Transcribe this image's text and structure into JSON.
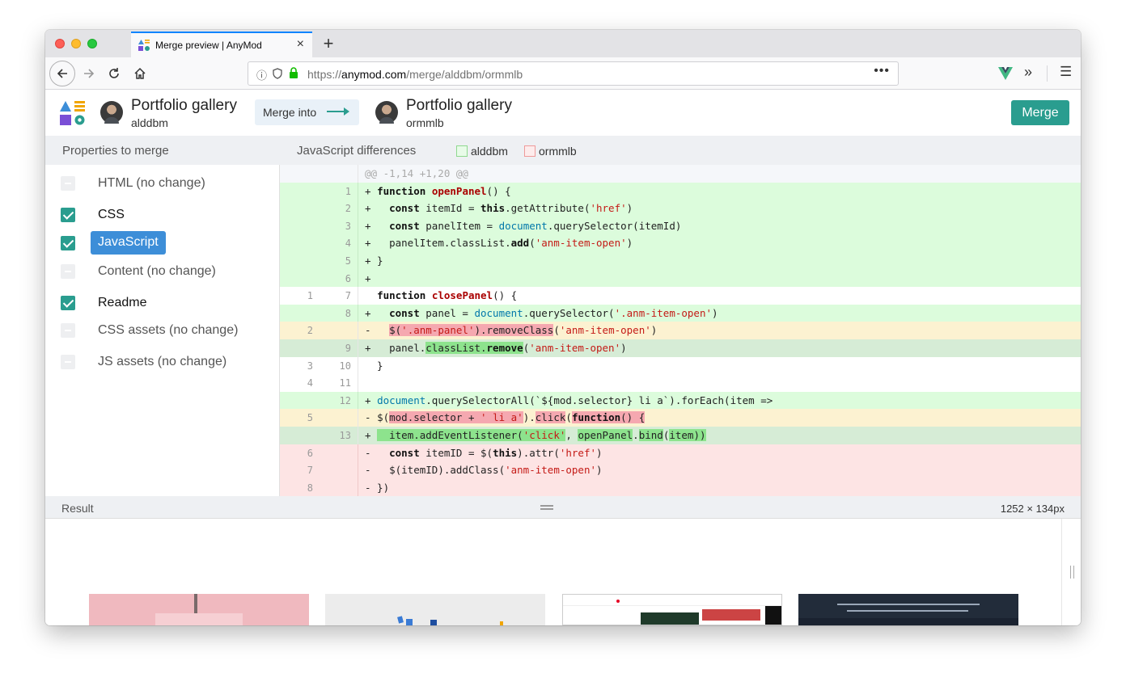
{
  "browser": {
    "tab_title": "Merge preview | AnyMod",
    "url_scheme": "https://",
    "url_host": "anymod.com",
    "url_path": "/merge/alddbm/ormmlb"
  },
  "header": {
    "source": {
      "name": "Portfolio gallery",
      "user": "alddbm"
    },
    "merge_into_label": "Merge into",
    "target": {
      "name": "Portfolio gallery",
      "user": "ormmlb"
    },
    "merge_button": "Merge"
  },
  "subheader": {
    "properties_title": "Properties to merge",
    "diff_title": "JavaScript differences",
    "legend_source": "alddbm",
    "legend_target": "ormmlb"
  },
  "properties": [
    {
      "label": "HTML (no change)",
      "state": "none"
    },
    {
      "label": "CSS",
      "state": "checked"
    },
    {
      "label": "JavaScript",
      "state": "selected"
    },
    {
      "label": "Content (no change)",
      "state": "none"
    },
    {
      "label": "Readme",
      "state": "checked"
    },
    {
      "label": "CSS assets (no change)",
      "state": "none"
    },
    {
      "label": "JS assets (no change)",
      "state": "none"
    }
  ],
  "diff": {
    "hunk_header": "@@ -1,14 +1,20 @@",
    "lines": [
      {
        "old": "",
        "new": "1"
      },
      {
        "old": "",
        "new": "2"
      },
      {
        "old": "",
        "new": "3"
      },
      {
        "old": "",
        "new": "4"
      },
      {
        "old": "",
        "new": "5"
      },
      {
        "old": "",
        "new": "6"
      },
      {
        "old": "1",
        "new": "7"
      },
      {
        "old": "",
        "new": "8"
      },
      {
        "old": "2",
        "new": ""
      },
      {
        "old": "",
        "new": "9"
      },
      {
        "old": "3",
        "new": "10"
      },
      {
        "old": "4",
        "new": "11"
      },
      {
        "old": "",
        "new": "12"
      },
      {
        "old": "5",
        "new": ""
      },
      {
        "old": "",
        "new": "13"
      },
      {
        "old": "6",
        "new": ""
      },
      {
        "old": "7",
        "new": ""
      },
      {
        "old": "8",
        "new": ""
      }
    ],
    "code": {
      "l1_plus": "+ ",
      "l1_kw": "function",
      "l1_sp": " ",
      "l1_fn": "openPanel",
      "l1_rest": "() {",
      "l2_plus": "+   ",
      "l2_kw": "const",
      "l2_a": " itemId = ",
      "l2_this": "this",
      "l2_b": ".getAttribute(",
      "l2_str": "'href'",
      "l2_c": ")",
      "l3_plus": "+   ",
      "l3_kw": "const",
      "l3_a": " panelItem = ",
      "l3_doc": "document",
      "l3_b": ".querySelector(itemId)",
      "l4_plus": "+   ",
      "l4_a": "panelItem.classList.",
      "l4_add": "add",
      "l4_b": "(",
      "l4_str": "'anm-item-open'",
      "l4_c": ")",
      "l5": "+ }",
      "l6": "+",
      "l7_sp": "  ",
      "l7_kw": "function",
      "l7_s2": " ",
      "l7_fn": "closePanel",
      "l7_rest": "() {",
      "l8_plus": "+   ",
      "l8_kw": "const",
      "l8_a": " panel = ",
      "l8_doc": "document",
      "l8_b": ".querySelector(",
      "l8_str": "'.anm-item-open'",
      "l8_c": ")",
      "l9_minus": "-   ",
      "l9_a": "$(",
      "l9_str": "'.anm-panel'",
      "l9_b": ").",
      "l9_rm": "removeClass",
      "l9_c": "(",
      "l9_str2": "'anm-item-open'",
      "l9_d": ")",
      "l10_plus": "+   ",
      "l10_a": "panel.",
      "l10_cl": "classList.",
      "l10_rm": "remove",
      "l10_b": "(",
      "l10_str": "'anm-item-open'",
      "l10_c": ")",
      "l11": "  }",
      "l12": "",
      "l13_plus": "+ ",
      "l13_doc": "document",
      "l13_a": ".querySelectorAll(`${mod.selector} li a`).forEach(item =>",
      "l14_minus": "- ",
      "l14_a": "$(",
      "l14_h1": "mod.selector + ",
      "l14_str": "' li a'",
      "l14_b": ").",
      "l14_click": "click",
      "l14_c": "(",
      "l14_fn": "function",
      "l14_d": "() {",
      "l15_plus": "+ ",
      "l15_a": "  item.addEventListener(",
      "l15_str": "'click'",
      "l15_b": ", ",
      "l15_h2": "openPanel",
      "l15_c": ".",
      "l15_bind": "bind",
      "l15_d": "(",
      "l15_item": "item",
      "l15_e": "))",
      "l16_minus": "-   ",
      "l16_kw": "const",
      "l16_a": " itemID = $(",
      "l16_this": "this",
      "l16_b": ").attr(",
      "l16_str": "'href'",
      "l16_c": ")",
      "l17_minus": "-   ",
      "l17_a": "$(itemID).addClass(",
      "l17_str": "'anm-item-open'",
      "l17_b": ")",
      "l18": "- })"
    }
  },
  "result": {
    "label": "Result",
    "size": "1252 × 134px"
  },
  "colors": {
    "accent": "#2a9d8f",
    "selected": "#3d8ed8",
    "add_bg": "#dcfcdc",
    "del_bg": "#fde4e4"
  }
}
